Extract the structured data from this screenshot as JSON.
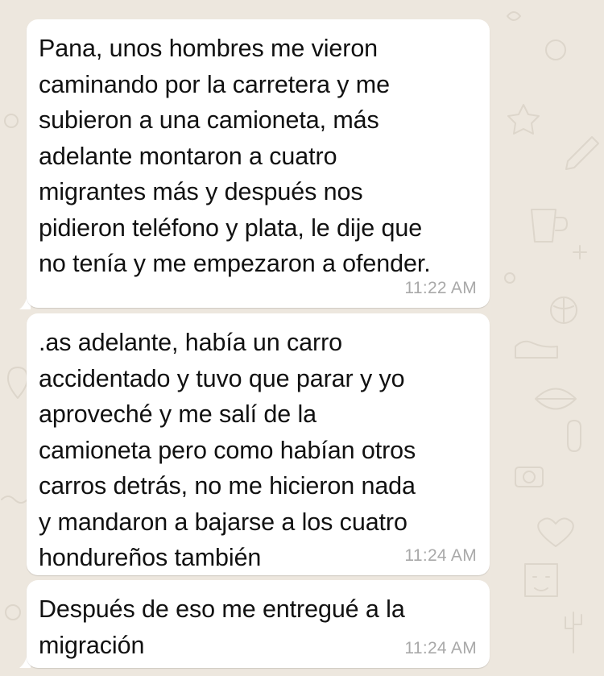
{
  "chat": {
    "background_color": "#ede7de",
    "bubble_color": "#ffffff",
    "messages": [
      {
        "text": "Pana, unos hombres me vieron\ncaminando por la carretera y me\nsubieron a una camioneta, más\nadelante montaron a cuatro\nmigrantes más y después nos\npidieron teléfono y plata, le dije que\nno tenía y me empezaron a ofender.",
        "time": "11:22 AM"
      },
      {
        "text": ".as adelante, había un carro\naccidentado y tuvo que parar y yo\naproveché y me salí de la\ncamioneta pero como habían otros\ncarros detrás, no me hicieron nada\ny mandaron a bajarse a los cuatro\nhondureños también",
        "time": "11:24 AM"
      },
      {
        "text": "Después de eso me entregué a la\nmigración",
        "time": "11:24 AM"
      }
    ]
  }
}
